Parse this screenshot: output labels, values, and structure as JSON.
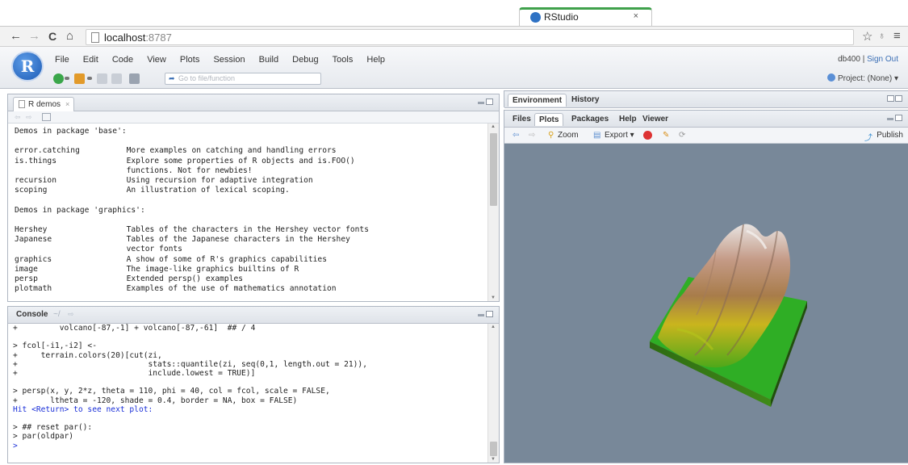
{
  "browser": {
    "tab_title": "RStudio",
    "tab_close": "×",
    "url_host": "localhost",
    "url_port": ":8787",
    "back": "←",
    "forward": "→",
    "reload": "C",
    "home": "⌂",
    "star": "☆",
    "menu": "≡"
  },
  "menubar": [
    "File",
    "Edit",
    "Code",
    "View",
    "Plots",
    "Session",
    "Build",
    "Debug",
    "Tools",
    "Help"
  ],
  "toolbar": {
    "goto_placeholder": "Go to file/function",
    "user": "db400",
    "separator": " | ",
    "signout": "Sign Out",
    "project": "Project: (None) ▾"
  },
  "source_pane": {
    "tab_label": "R demos",
    "tab_close": "×",
    "lines": [
      "Demos in package 'base':",
      "",
      "error.catching          More examples on catching and handling errors",
      "is.things               Explore some properties of R objects and is.FOO()",
      "                        functions. Not for newbies!",
      "recursion               Using recursion for adaptive integration",
      "scoping                 An illustration of lexical scoping.",
      "",
      "Demos in package 'graphics':",
      "",
      "Hershey                 Tables of the characters in the Hershey vector fonts",
      "Japanese                Tables of the Japanese characters in the Hershey",
      "                        vector fonts",
      "graphics                A show of some of R's graphics capabilities",
      "image                   The image-like graphics builtins of R",
      "persp                   Extended persp() examples",
      "plotmath                Examples of the use of mathematics annotation"
    ]
  },
  "console": {
    "label": "Console",
    "path": "~/",
    "lines": [
      {
        "text": "+         volcano[-87,-1] + volcano[-87,-61]  ## / 4",
        "blue": false
      },
      {
        "text": "",
        "blue": false
      },
      {
        "text": "> fcol[-i1,-i2] <-",
        "blue": false
      },
      {
        "text": "+     terrain.colors(20)[cut(zi,",
        "blue": false
      },
      {
        "text": "+                            stats::quantile(zi, seq(0,1, length.out = 21)),",
        "blue": false
      },
      {
        "text": "+                            include.lowest = TRUE)]",
        "blue": false
      },
      {
        "text": "",
        "blue": false
      },
      {
        "text": "> persp(x, y, 2*z, theta = 110, phi = 40, col = fcol, scale = FALSE,",
        "blue": false
      },
      {
        "text": "+       ltheta = -120, shade = 0.4, border = NA, box = FALSE)",
        "blue": false
      },
      {
        "text": "Hit <Return> to see next plot:",
        "blue": true
      },
      {
        "text": "",
        "blue": false
      },
      {
        "text": "> ## reset par():",
        "blue": false
      },
      {
        "text": "> par(oldpar)",
        "blue": false
      },
      {
        "text": ">",
        "blue": true
      }
    ]
  },
  "env_pane": {
    "tabs": [
      "Environment",
      "History"
    ]
  },
  "plot_pane": {
    "tabs": [
      "Files",
      "Plots",
      "Packages",
      "Help",
      "Viewer"
    ],
    "active_tab": "Plots",
    "zoom": "Zoom",
    "export": "Export ▾",
    "publish": "Publish"
  }
}
